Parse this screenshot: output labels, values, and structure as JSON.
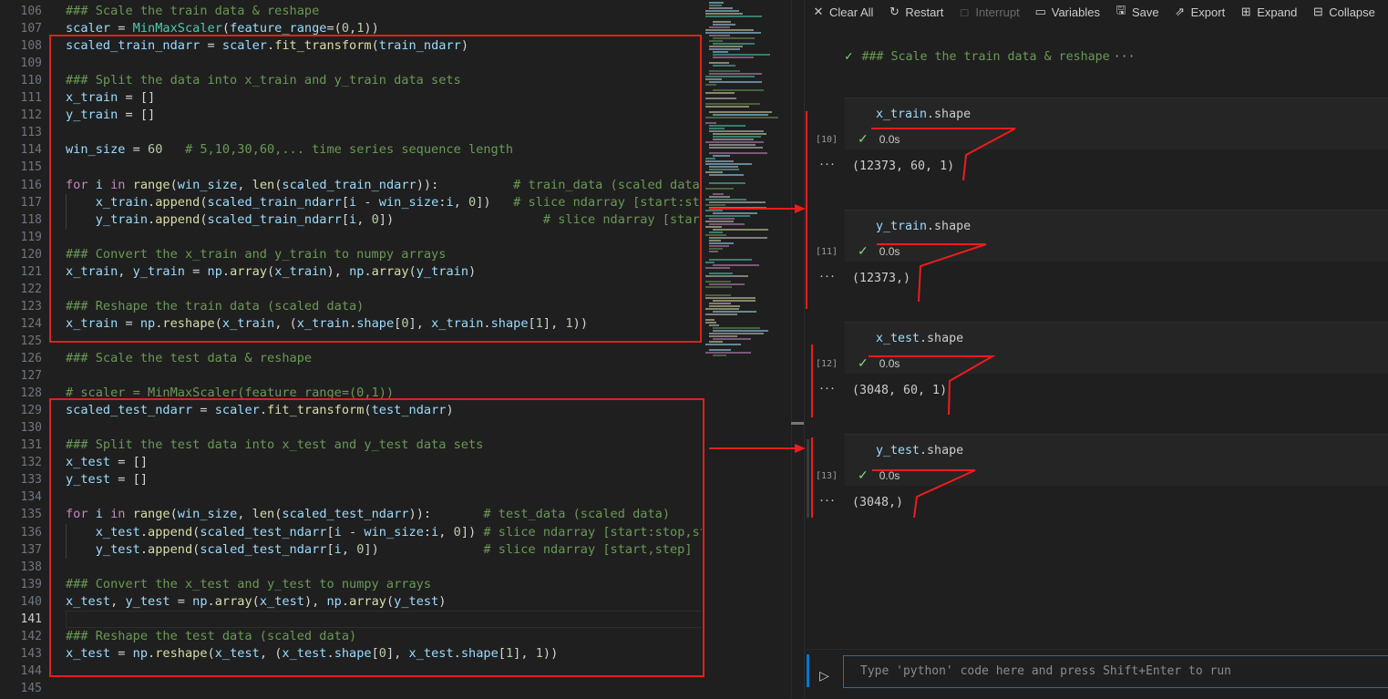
{
  "editor": {
    "lines": [
      {
        "num": "106",
        "tokens": [
          [
            "c-com",
            "### Scale the train data & reshape"
          ]
        ]
      },
      {
        "num": "107",
        "tokens": [
          [
            "c-var",
            "scaler"
          ],
          [
            "c-op",
            " = "
          ],
          [
            "c-cls",
            "MinMaxScaler"
          ],
          [
            "c-op",
            "("
          ],
          [
            "c-var",
            "feature_range"
          ],
          [
            "c-op",
            "=("
          ],
          [
            "c-num",
            "0"
          ],
          [
            "c-op",
            ","
          ],
          [
            "c-num",
            "1"
          ],
          [
            "c-op",
            "))"
          ]
        ]
      },
      {
        "num": "108",
        "tokens": [
          [
            "c-var",
            "scaled_train_ndarr"
          ],
          [
            "c-op",
            " = "
          ],
          [
            "c-var",
            "scaler"
          ],
          [
            "c-op",
            "."
          ],
          [
            "c-fn",
            "fit_transform"
          ],
          [
            "c-op",
            "("
          ],
          [
            "c-var",
            "train_ndarr"
          ],
          [
            "c-op",
            ")"
          ]
        ]
      },
      {
        "num": "109",
        "tokens": []
      },
      {
        "num": "110",
        "tokens": [
          [
            "c-com",
            "### Split the data into x_train and y_train data sets"
          ]
        ]
      },
      {
        "num": "111",
        "tokens": [
          [
            "c-var",
            "x_train"
          ],
          [
            "c-op",
            " = []"
          ]
        ]
      },
      {
        "num": "112",
        "tokens": [
          [
            "c-var",
            "y_train"
          ],
          [
            "c-op",
            " = []"
          ]
        ]
      },
      {
        "num": "113",
        "tokens": []
      },
      {
        "num": "114",
        "tokens": [
          [
            "c-var",
            "win_size"
          ],
          [
            "c-op",
            " = "
          ],
          [
            "c-num",
            "60"
          ],
          [
            "c-com",
            "   # 5,10,30,60,... time series sequence length"
          ]
        ]
      },
      {
        "num": "115",
        "tokens": []
      },
      {
        "num": "116",
        "tokens": [
          [
            "c-kw",
            "for"
          ],
          [
            "c-op",
            " "
          ],
          [
            "c-var",
            "i"
          ],
          [
            "c-op",
            " "
          ],
          [
            "c-kw",
            "in"
          ],
          [
            "c-op",
            " "
          ],
          [
            "c-fn",
            "range"
          ],
          [
            "c-op",
            "("
          ],
          [
            "c-var",
            "win_size"
          ],
          [
            "c-op",
            ", "
          ],
          [
            "c-fn",
            "len"
          ],
          [
            "c-op",
            "("
          ],
          [
            "c-var",
            "scaled_train_ndarr"
          ],
          [
            "c-op",
            "))"
          ],
          [
            "c-op",
            ":"
          ],
          [
            "c-com",
            "          # train_data (scaled data)"
          ]
        ]
      },
      {
        "num": "117",
        "tokens": [
          [
            "c-op",
            "    "
          ],
          [
            "c-var",
            "x_train"
          ],
          [
            "c-op",
            "."
          ],
          [
            "c-fn",
            "append"
          ],
          [
            "c-op",
            "("
          ],
          [
            "c-var",
            "scaled_train_ndarr"
          ],
          [
            "c-op",
            "["
          ],
          [
            "c-var",
            "i"
          ],
          [
            "c-op",
            " - "
          ],
          [
            "c-var",
            "win_size"
          ],
          [
            "c-op",
            ":"
          ],
          [
            "c-var",
            "i"
          ],
          [
            "c-op",
            ", "
          ],
          [
            "c-num",
            "0"
          ],
          [
            "c-op",
            "])"
          ],
          [
            "c-com",
            "   # slice ndarray [start:stop,step]"
          ]
        ]
      },
      {
        "num": "118",
        "tokens": [
          [
            "c-op",
            "    "
          ],
          [
            "c-var",
            "y_train"
          ],
          [
            "c-op",
            "."
          ],
          [
            "c-fn",
            "append"
          ],
          [
            "c-op",
            "("
          ],
          [
            "c-var",
            "scaled_train_ndarr"
          ],
          [
            "c-op",
            "["
          ],
          [
            "c-var",
            "i"
          ],
          [
            "c-op",
            ", "
          ],
          [
            "c-num",
            "0"
          ],
          [
            "c-op",
            "])"
          ],
          [
            "c-com",
            "                    # slice ndarray [start,step]"
          ]
        ]
      },
      {
        "num": "119",
        "tokens": []
      },
      {
        "num": "120",
        "tokens": [
          [
            "c-com",
            "### Convert the x_train and y_train to numpy arrays"
          ]
        ]
      },
      {
        "num": "121",
        "tokens": [
          [
            "c-var",
            "x_train"
          ],
          [
            "c-op",
            ", "
          ],
          [
            "c-var",
            "y_train"
          ],
          [
            "c-op",
            " = "
          ],
          [
            "c-var",
            "np"
          ],
          [
            "c-op",
            "."
          ],
          [
            "c-fn",
            "array"
          ],
          [
            "c-op",
            "("
          ],
          [
            "c-var",
            "x_train"
          ],
          [
            "c-op",
            "), "
          ],
          [
            "c-var",
            "np"
          ],
          [
            "c-op",
            "."
          ],
          [
            "c-fn",
            "array"
          ],
          [
            "c-op",
            "("
          ],
          [
            "c-var",
            "y_train"
          ],
          [
            "c-op",
            ")"
          ]
        ]
      },
      {
        "num": "122",
        "tokens": []
      },
      {
        "num": "123",
        "tokens": [
          [
            "c-com",
            "### Reshape the train data (scaled data)"
          ]
        ]
      },
      {
        "num": "124",
        "tokens": [
          [
            "c-var",
            "x_train"
          ],
          [
            "c-op",
            " = "
          ],
          [
            "c-var",
            "np"
          ],
          [
            "c-op",
            "."
          ],
          [
            "c-fn",
            "reshape"
          ],
          [
            "c-op",
            "("
          ],
          [
            "c-var",
            "x_train"
          ],
          [
            "c-op",
            ", ("
          ],
          [
            "c-var",
            "x_train"
          ],
          [
            "c-op",
            "."
          ],
          [
            "c-var",
            "shape"
          ],
          [
            "c-op",
            "["
          ],
          [
            "c-num",
            "0"
          ],
          [
            "c-op",
            "], "
          ],
          [
            "c-var",
            "x_train"
          ],
          [
            "c-op",
            "."
          ],
          [
            "c-var",
            "shape"
          ],
          [
            "c-op",
            "["
          ],
          [
            "c-num",
            "1"
          ],
          [
            "c-op",
            "], "
          ],
          [
            "c-num",
            "1"
          ],
          [
            "c-op",
            "))"
          ]
        ]
      },
      {
        "num": "125",
        "tokens": []
      },
      {
        "num": "126",
        "tokens": [
          [
            "c-com",
            "### Scale the test data & reshape"
          ]
        ]
      },
      {
        "num": "127",
        "tokens": []
      },
      {
        "num": "128",
        "tokens": [
          [
            "c-com",
            "# scaler = MinMaxScaler(feature_range=(0,1))"
          ]
        ]
      },
      {
        "num": "129",
        "tokens": [
          [
            "c-var",
            "scaled_test_ndarr"
          ],
          [
            "c-op",
            " = "
          ],
          [
            "c-var",
            "scaler"
          ],
          [
            "c-op",
            "."
          ],
          [
            "c-fn",
            "fit_transform"
          ],
          [
            "c-op",
            "("
          ],
          [
            "c-var",
            "test_ndarr"
          ],
          [
            "c-op",
            ")"
          ]
        ]
      },
      {
        "num": "130",
        "tokens": []
      },
      {
        "num": "131",
        "tokens": [
          [
            "c-com",
            "### Split the test data into x_test and y_test data sets"
          ]
        ]
      },
      {
        "num": "132",
        "tokens": [
          [
            "c-var",
            "x_test"
          ],
          [
            "c-op",
            " = []"
          ]
        ]
      },
      {
        "num": "133",
        "tokens": [
          [
            "c-var",
            "y_test"
          ],
          [
            "c-op",
            " = []"
          ]
        ]
      },
      {
        "num": "134",
        "tokens": []
      },
      {
        "num": "135",
        "tokens": [
          [
            "c-kw",
            "for"
          ],
          [
            "c-op",
            " "
          ],
          [
            "c-var",
            "i"
          ],
          [
            "c-op",
            " "
          ],
          [
            "c-kw",
            "in"
          ],
          [
            "c-op",
            " "
          ],
          [
            "c-fn",
            "range"
          ],
          [
            "c-op",
            "("
          ],
          [
            "c-var",
            "win_size"
          ],
          [
            "c-op",
            ", "
          ],
          [
            "c-fn",
            "len"
          ],
          [
            "c-op",
            "("
          ],
          [
            "c-var",
            "scaled_test_ndarr"
          ],
          [
            "c-op",
            "))"
          ],
          [
            "c-op",
            ":"
          ],
          [
            "c-com",
            "       # test_data (scaled data)"
          ]
        ]
      },
      {
        "num": "136",
        "tokens": [
          [
            "c-op",
            "    "
          ],
          [
            "c-var",
            "x_test"
          ],
          [
            "c-op",
            "."
          ],
          [
            "c-fn",
            "append"
          ],
          [
            "c-op",
            "("
          ],
          [
            "c-var",
            "scaled_test_ndarr"
          ],
          [
            "c-op",
            "["
          ],
          [
            "c-var",
            "i"
          ],
          [
            "c-op",
            " - "
          ],
          [
            "c-var",
            "win_size"
          ],
          [
            "c-op",
            ":"
          ],
          [
            "c-var",
            "i"
          ],
          [
            "c-op",
            ", "
          ],
          [
            "c-num",
            "0"
          ],
          [
            "c-op",
            "])"
          ],
          [
            "c-com",
            " # slice ndarray [start:stop,step]"
          ]
        ]
      },
      {
        "num": "137",
        "tokens": [
          [
            "c-op",
            "    "
          ],
          [
            "c-var",
            "y_test"
          ],
          [
            "c-op",
            "."
          ],
          [
            "c-fn",
            "append"
          ],
          [
            "c-op",
            "("
          ],
          [
            "c-var",
            "scaled_test_ndarr"
          ],
          [
            "c-op",
            "["
          ],
          [
            "c-var",
            "i"
          ],
          [
            "c-op",
            ", "
          ],
          [
            "c-num",
            "0"
          ],
          [
            "c-op",
            "])"
          ],
          [
            "c-com",
            "              # slice ndarray [start,step]"
          ]
        ]
      },
      {
        "num": "138",
        "tokens": []
      },
      {
        "num": "139",
        "tokens": [
          [
            "c-com",
            "### Convert the x_test and y_test to numpy arrays"
          ]
        ]
      },
      {
        "num": "140",
        "tokens": [
          [
            "c-var",
            "x_test"
          ],
          [
            "c-op",
            ", "
          ],
          [
            "c-var",
            "y_test"
          ],
          [
            "c-op",
            " = "
          ],
          [
            "c-var",
            "np"
          ],
          [
            "c-op",
            "."
          ],
          [
            "c-fn",
            "array"
          ],
          [
            "c-op",
            "("
          ],
          [
            "c-var",
            "x_test"
          ],
          [
            "c-op",
            "), "
          ],
          [
            "c-var",
            "np"
          ],
          [
            "c-op",
            "."
          ],
          [
            "c-fn",
            "array"
          ],
          [
            "c-op",
            "("
          ],
          [
            "c-var",
            "y_test"
          ],
          [
            "c-op",
            ")"
          ]
        ]
      },
      {
        "num": "141",
        "tokens": [],
        "current": true
      },
      {
        "num": "142",
        "tokens": [
          [
            "c-com",
            "### Reshape the test data (scaled data)"
          ]
        ]
      },
      {
        "num": "143",
        "tokens": [
          [
            "c-var",
            "x_test"
          ],
          [
            "c-op",
            " = "
          ],
          [
            "c-var",
            "np"
          ],
          [
            "c-op",
            "."
          ],
          [
            "c-fn",
            "reshape"
          ],
          [
            "c-op",
            "("
          ],
          [
            "c-var",
            "x_test"
          ],
          [
            "c-op",
            ", ("
          ],
          [
            "c-var",
            "x_test"
          ],
          [
            "c-op",
            "."
          ],
          [
            "c-var",
            "shape"
          ],
          [
            "c-op",
            "["
          ],
          [
            "c-num",
            "0"
          ],
          [
            "c-op",
            "], "
          ],
          [
            "c-var",
            "x_test"
          ],
          [
            "c-op",
            "."
          ],
          [
            "c-var",
            "shape"
          ],
          [
            "c-op",
            "["
          ],
          [
            "c-num",
            "1"
          ],
          [
            "c-op",
            "], "
          ],
          [
            "c-num",
            "1"
          ],
          [
            "c-op",
            "))"
          ]
        ]
      },
      {
        "num": "144",
        "tokens": []
      },
      {
        "num": "145",
        "tokens": []
      }
    ]
  },
  "toolbar": {
    "clear_all": "Clear All",
    "restart": "Restart",
    "interrupt": "Interrupt",
    "variables": "Variables",
    "save": "Save",
    "export": "Export",
    "expand": "Expand",
    "collapse": "Collapse"
  },
  "interactive": {
    "collapsed_header": "### Scale the train data & reshape",
    "collapsed_ellipsis": "···",
    "cells": [
      {
        "exec": "[10]",
        "source_var": "x_train",
        "source_attr": ".shape",
        "time": "0.0s",
        "output": "(12373, 60, 1)"
      },
      {
        "exec": "[11]",
        "source_var": "y_train",
        "source_attr": ".shape",
        "time": "0.0s",
        "output": "(12373,)"
      },
      {
        "exec": "[12]",
        "source_var": "x_test",
        "source_attr": ".shape",
        "time": "0.0s",
        "output": "(3048, 60, 1)"
      },
      {
        "exec": "[13]",
        "source_var": "y_test",
        "source_attr": ".shape",
        "time": "0.0s",
        "output": "(3048,)"
      }
    ],
    "more_glyph": "···",
    "input_placeholder": "Type 'python' code here and press Shift+Enter to run"
  },
  "icons": {
    "clear": "close-icon",
    "restart": "restart-icon",
    "interrupt": "stop-icon",
    "variables": "variables-icon",
    "save": "save-icon",
    "export": "export-icon",
    "expand": "expand-icon",
    "collapse": "collapse-icon",
    "run": "run-icon",
    "check": "check-icon"
  },
  "colors": {
    "annotation": "#e02020",
    "accent": "#0078d4",
    "success": "#89d185"
  }
}
